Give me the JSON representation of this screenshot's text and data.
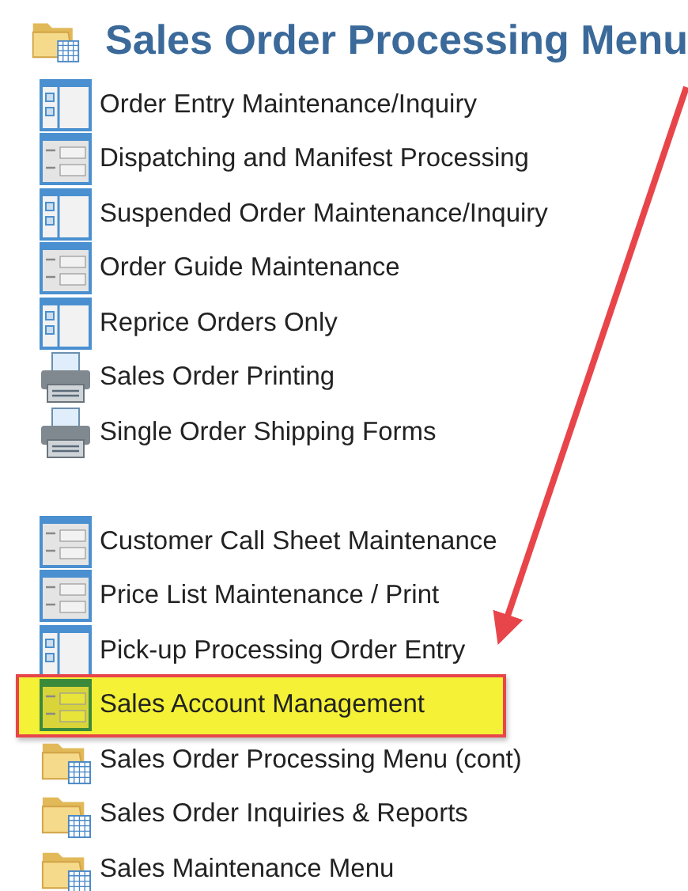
{
  "title": "Sales Order Processing Menu",
  "groups": [
    {
      "items": [
        {
          "kind": "split-form",
          "label": "Order Entry Maintenance/Inquiry",
          "highlighted": false
        },
        {
          "kind": "field-form",
          "label": "Dispatching and Manifest Processing",
          "highlighted": false
        },
        {
          "kind": "split-form",
          "label": "Suspended Order Maintenance/Inquiry",
          "highlighted": false
        },
        {
          "kind": "field-form",
          "label": "Order Guide Maintenance",
          "highlighted": false
        },
        {
          "kind": "split-form",
          "label": "Reprice Orders Only",
          "highlighted": false
        },
        {
          "kind": "printer",
          "label": "Sales Order Printing",
          "highlighted": false
        },
        {
          "kind": "printer",
          "label": "Single Order Shipping Forms",
          "highlighted": false
        }
      ]
    },
    {
      "items": [
        {
          "kind": "field-form",
          "label": "Customer Call Sheet Maintenance",
          "highlighted": false
        },
        {
          "kind": "field-form",
          "label": "Price List Maintenance / Print",
          "highlighted": false
        },
        {
          "kind": "split-form",
          "label": "Pick-up Processing Order Entry",
          "highlighted": false
        },
        {
          "kind": "field-form",
          "label": "Sales Account Management",
          "highlighted": true
        },
        {
          "kind": "folder",
          "label": "Sales Order Processing Menu (cont)",
          "highlighted": false
        },
        {
          "kind": "folder",
          "label": "Sales Order Inquiries & Reports",
          "highlighted": false
        },
        {
          "kind": "folder",
          "label": "Sales Maintenance Menu",
          "highlighted": false
        }
      ]
    }
  ]
}
